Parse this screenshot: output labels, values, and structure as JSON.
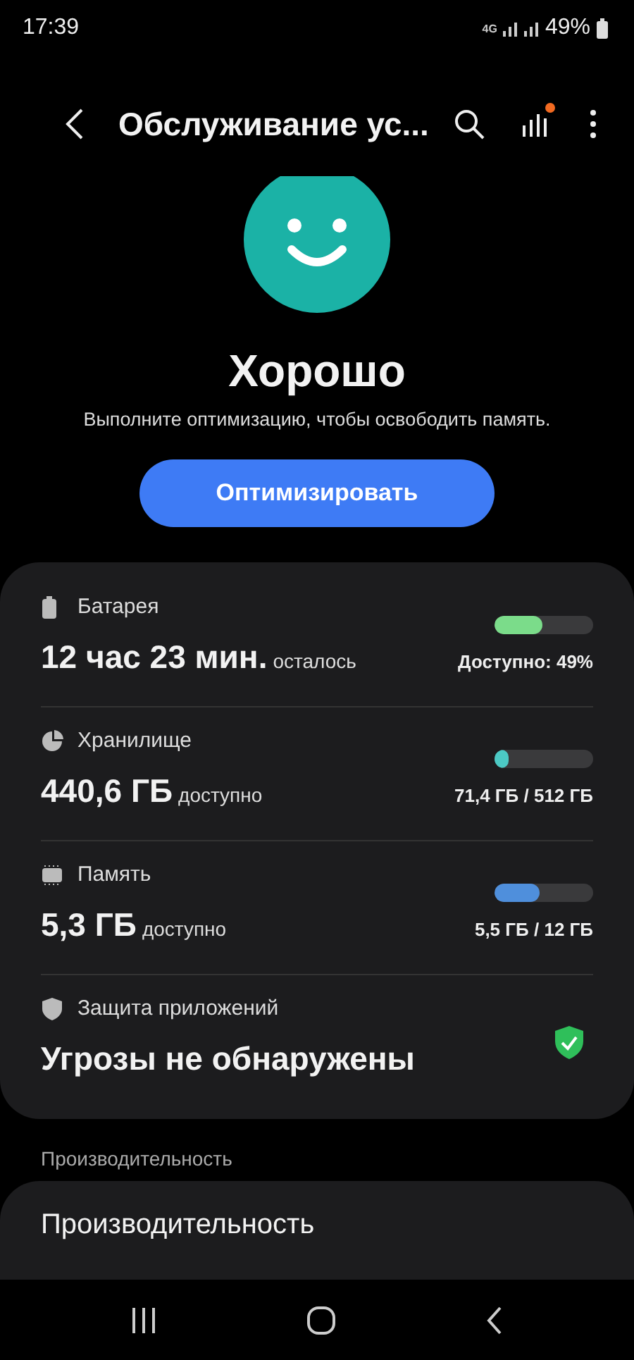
{
  "status_bar": {
    "time": "17:39",
    "network": "4G",
    "battery": "49%"
  },
  "header": {
    "title": "Обслуживание ус...",
    "notification_dot": true
  },
  "hero": {
    "status": "Хорошо",
    "message": "Выполните оптимизацию, чтобы освободить память.",
    "button": "Оптимизировать"
  },
  "items": [
    {
      "kind": "meter",
      "label": "Батарея",
      "value": "12 час 23 мин.",
      "unit": "осталось",
      "reading": "Доступно: 49%",
      "level": 0.49,
      "color": "#7bdc8a"
    },
    {
      "kind": "meter",
      "label": "Хранилище",
      "value": "440,6 ГБ",
      "unit": "доступно",
      "reading": "**71,4 ГБ** / 512 ГБ",
      "level": 0.14,
      "color": "#4cc9c4"
    },
    {
      "kind": "meter",
      "label": "Память",
      "value": "5,3 ГБ",
      "unit": "доступно",
      "reading": "**5,5 ГБ** / 12 ГБ",
      "level": 0.46,
      "color": "#4f8fdc"
    },
    {
      "kind": "status",
      "label": "Защита приложений",
      "value": "Угрозы не обнаружены",
      "safe": true
    }
  ],
  "section": {
    "title": "Производительность",
    "item": "Производительность"
  }
}
